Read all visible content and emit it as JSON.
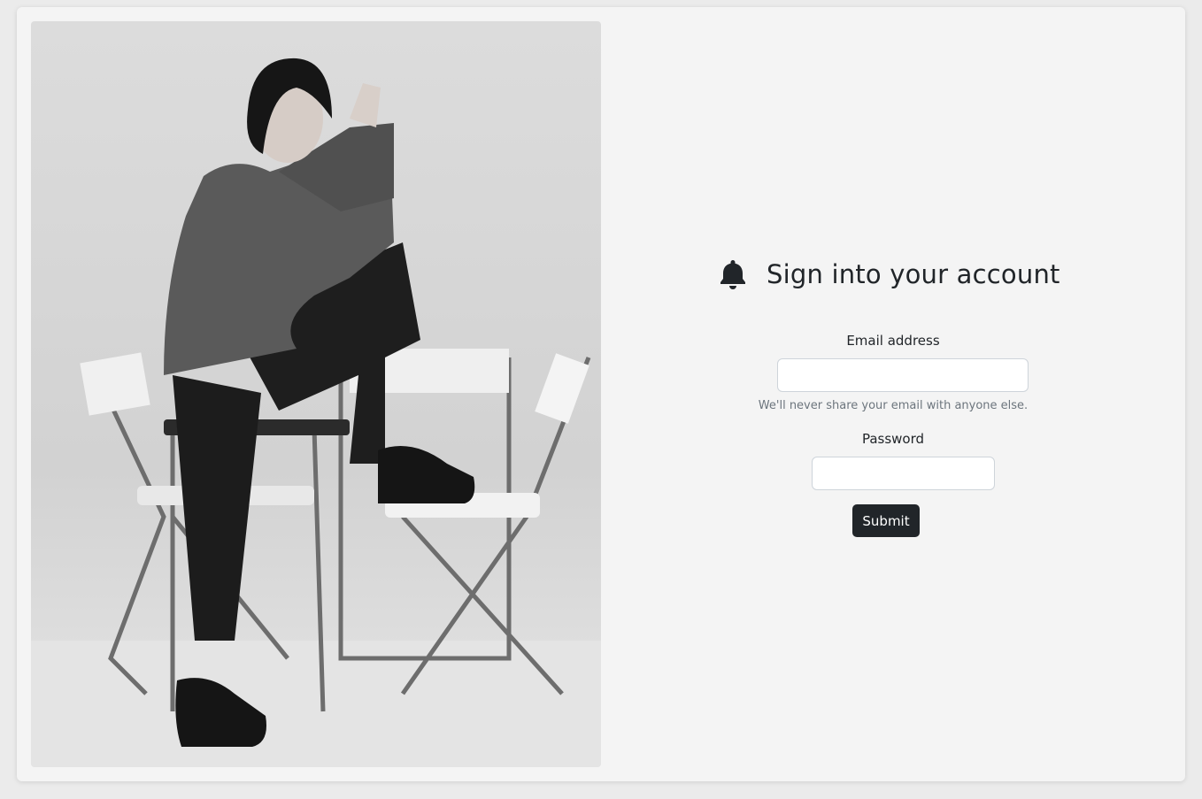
{
  "login": {
    "title": "Sign into your account",
    "email_label": "Email address",
    "email_value": "",
    "email_hint": "We'll never share your email with anyone else.",
    "password_label": "Password",
    "password_value": "",
    "submit_label": "Submit"
  },
  "icons": {
    "title_icon": "bell-icon"
  },
  "colors": {
    "page_background": "#ebebeb",
    "card_background": "#f4f4f4",
    "button_background": "#212529",
    "button_text": "#ffffff",
    "hint_text": "#6c757d"
  }
}
